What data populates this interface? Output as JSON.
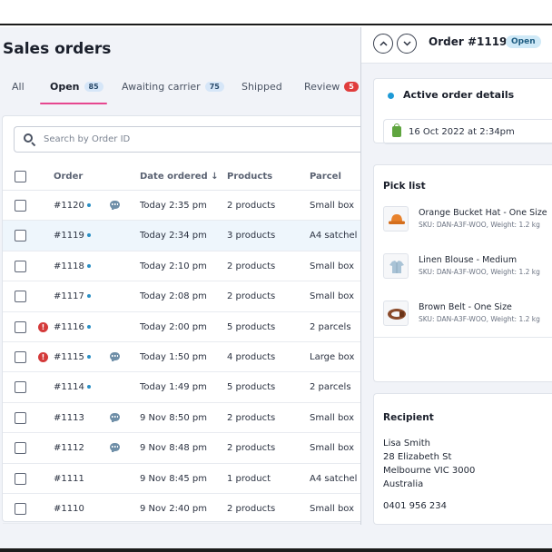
{
  "page_title": "Sales orders",
  "tabs": [
    {
      "label": "All",
      "badge": ""
    },
    {
      "label": "Open",
      "badge": "85"
    },
    {
      "label": "Awaiting carrier",
      "badge": "75"
    },
    {
      "label": "Shipped",
      "badge": ""
    },
    {
      "label": "Review",
      "badge": "5"
    }
  ],
  "search": {
    "placeholder": "Search by Order ID"
  },
  "table": {
    "columns": [
      "Order",
      "Date ordered ↓",
      "Products",
      "Parcel"
    ],
    "rows": [
      {
        "order": "#1120",
        "date": "Today 2:35 pm",
        "products": "2 products",
        "parcel": "Small box",
        "dot": true,
        "alert": false,
        "comment": true
      },
      {
        "order": "#1119",
        "date": "Today 2:34 pm",
        "products": "3 products",
        "parcel": "A4 satchel",
        "dot": true,
        "alert": false,
        "comment": false
      },
      {
        "order": "#1118",
        "date": "Today 2:10 pm",
        "products": "2 products",
        "parcel": "Small box",
        "dot": true,
        "alert": false,
        "comment": false
      },
      {
        "order": "#1117",
        "date": "Today 2:08 pm",
        "products": "2 products",
        "parcel": "Small box",
        "dot": true,
        "alert": false,
        "comment": false
      },
      {
        "order": "#1116",
        "date": "Today 2:00 pm",
        "products": "5 products",
        "parcel": "2 parcels",
        "dot": true,
        "alert": true,
        "comment": false
      },
      {
        "order": "#1115",
        "date": "Today 1:50 pm",
        "products": "4 products",
        "parcel": "Large box",
        "dot": true,
        "alert": true,
        "comment": true
      },
      {
        "order": "#1114",
        "date": "Today 1:49 pm",
        "products": "5 products",
        "parcel": "2 parcels",
        "dot": true,
        "alert": false,
        "comment": false
      },
      {
        "order": "#1113",
        "date": "9 Nov 8:50 pm",
        "products": "2 products",
        "parcel": "Small box",
        "dot": false,
        "alert": false,
        "comment": true
      },
      {
        "order": "#1112",
        "date": "9 Nov 8:48 pm",
        "products": "2 products",
        "parcel": "Small box",
        "dot": false,
        "alert": false,
        "comment": true
      },
      {
        "order": "#1111",
        "date": "9 Nov 8:45 pm",
        "products": "1 product",
        "parcel": "A4 satchel",
        "dot": false,
        "alert": false,
        "comment": false
      },
      {
        "order": "#1110",
        "date": "9 Nov 2:40 pm",
        "products": "2 products",
        "parcel": "Small box",
        "dot": false,
        "alert": false,
        "comment": false
      }
    ]
  },
  "order_panel": {
    "title": "Order #1119",
    "status": "Open",
    "nav_up_icon": "chevron-up-icon",
    "nav_down_icon": "chevron-down-icon",
    "active_details_title": "Active order details",
    "order_date": "16 Oct 2022 at 2:34pm",
    "pick_list_title": "Pick list",
    "pick_list": [
      {
        "name": "Orange Bucket Hat - One Size",
        "sku": "SKU: DAN-A3F-WOO, Weight: 1.2 kg",
        "icon": "hat-icon"
      },
      {
        "name": "Linen Blouse - Medium",
        "sku": "SKU: DAN-A3F-WOO, Weight: 1.2 kg",
        "icon": "blouse-icon"
      },
      {
        "name": "Brown Belt - One Size",
        "sku": "SKU: DAN-A3F-WOO, Weight: 1.2 kg",
        "icon": "belt-icon"
      }
    ],
    "recipient_title": "Recipient",
    "recipient": {
      "name": "Lisa Smith",
      "address1": "28 Elizabeth St",
      "address2": "Melbourne VIC 3000",
      "country": "Australia",
      "phone": "0401 956 234"
    }
  },
  "colors": {
    "accent_underline": "#e6468f",
    "open_badge": "#d6e6f8",
    "review_badge": "#e03c3c",
    "status_dot": "#2a8fc4",
    "alert": "#d43a3a",
    "selected_row": "#eef6fc"
  }
}
